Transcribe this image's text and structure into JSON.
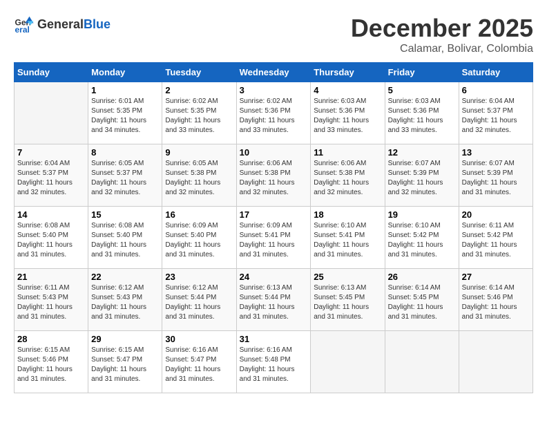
{
  "header": {
    "logo_general": "General",
    "logo_blue": "Blue",
    "month": "December 2025",
    "location": "Calamar, Bolivar, Colombia"
  },
  "weekdays": [
    "Sunday",
    "Monday",
    "Tuesday",
    "Wednesday",
    "Thursday",
    "Friday",
    "Saturday"
  ],
  "weeks": [
    [
      {
        "day": "",
        "sunrise": "",
        "sunset": "",
        "daylight": ""
      },
      {
        "day": "1",
        "sunrise": "Sunrise: 6:01 AM",
        "sunset": "Sunset: 5:35 PM",
        "daylight": "Daylight: 11 hours and 34 minutes."
      },
      {
        "day": "2",
        "sunrise": "Sunrise: 6:02 AM",
        "sunset": "Sunset: 5:35 PM",
        "daylight": "Daylight: 11 hours and 33 minutes."
      },
      {
        "day": "3",
        "sunrise": "Sunrise: 6:02 AM",
        "sunset": "Sunset: 5:36 PM",
        "daylight": "Daylight: 11 hours and 33 minutes."
      },
      {
        "day": "4",
        "sunrise": "Sunrise: 6:03 AM",
        "sunset": "Sunset: 5:36 PM",
        "daylight": "Daylight: 11 hours and 33 minutes."
      },
      {
        "day": "5",
        "sunrise": "Sunrise: 6:03 AM",
        "sunset": "Sunset: 5:36 PM",
        "daylight": "Daylight: 11 hours and 33 minutes."
      },
      {
        "day": "6",
        "sunrise": "Sunrise: 6:04 AM",
        "sunset": "Sunset: 5:37 PM",
        "daylight": "Daylight: 11 hours and 32 minutes."
      }
    ],
    [
      {
        "day": "7",
        "sunrise": "Sunrise: 6:04 AM",
        "sunset": "Sunset: 5:37 PM",
        "daylight": "Daylight: 11 hours and 32 minutes."
      },
      {
        "day": "8",
        "sunrise": "Sunrise: 6:05 AM",
        "sunset": "Sunset: 5:37 PM",
        "daylight": "Daylight: 11 hours and 32 minutes."
      },
      {
        "day": "9",
        "sunrise": "Sunrise: 6:05 AM",
        "sunset": "Sunset: 5:38 PM",
        "daylight": "Daylight: 11 hours and 32 minutes."
      },
      {
        "day": "10",
        "sunrise": "Sunrise: 6:06 AM",
        "sunset": "Sunset: 5:38 PM",
        "daylight": "Daylight: 11 hours and 32 minutes."
      },
      {
        "day": "11",
        "sunrise": "Sunrise: 6:06 AM",
        "sunset": "Sunset: 5:38 PM",
        "daylight": "Daylight: 11 hours and 32 minutes."
      },
      {
        "day": "12",
        "sunrise": "Sunrise: 6:07 AM",
        "sunset": "Sunset: 5:39 PM",
        "daylight": "Daylight: 11 hours and 32 minutes."
      },
      {
        "day": "13",
        "sunrise": "Sunrise: 6:07 AM",
        "sunset": "Sunset: 5:39 PM",
        "daylight": "Daylight: 11 hours and 31 minutes."
      }
    ],
    [
      {
        "day": "14",
        "sunrise": "Sunrise: 6:08 AM",
        "sunset": "Sunset: 5:40 PM",
        "daylight": "Daylight: 11 hours and 31 minutes."
      },
      {
        "day": "15",
        "sunrise": "Sunrise: 6:08 AM",
        "sunset": "Sunset: 5:40 PM",
        "daylight": "Daylight: 11 hours and 31 minutes."
      },
      {
        "day": "16",
        "sunrise": "Sunrise: 6:09 AM",
        "sunset": "Sunset: 5:40 PM",
        "daylight": "Daylight: 11 hours and 31 minutes."
      },
      {
        "day": "17",
        "sunrise": "Sunrise: 6:09 AM",
        "sunset": "Sunset: 5:41 PM",
        "daylight": "Daylight: 11 hours and 31 minutes."
      },
      {
        "day": "18",
        "sunrise": "Sunrise: 6:10 AM",
        "sunset": "Sunset: 5:41 PM",
        "daylight": "Daylight: 11 hours and 31 minutes."
      },
      {
        "day": "19",
        "sunrise": "Sunrise: 6:10 AM",
        "sunset": "Sunset: 5:42 PM",
        "daylight": "Daylight: 11 hours and 31 minutes."
      },
      {
        "day": "20",
        "sunrise": "Sunrise: 6:11 AM",
        "sunset": "Sunset: 5:42 PM",
        "daylight": "Daylight: 11 hours and 31 minutes."
      }
    ],
    [
      {
        "day": "21",
        "sunrise": "Sunrise: 6:11 AM",
        "sunset": "Sunset: 5:43 PM",
        "daylight": "Daylight: 11 hours and 31 minutes."
      },
      {
        "day": "22",
        "sunrise": "Sunrise: 6:12 AM",
        "sunset": "Sunset: 5:43 PM",
        "daylight": "Daylight: 11 hours and 31 minutes."
      },
      {
        "day": "23",
        "sunrise": "Sunrise: 6:12 AM",
        "sunset": "Sunset: 5:44 PM",
        "daylight": "Daylight: 11 hours and 31 minutes."
      },
      {
        "day": "24",
        "sunrise": "Sunrise: 6:13 AM",
        "sunset": "Sunset: 5:44 PM",
        "daylight": "Daylight: 11 hours and 31 minutes."
      },
      {
        "day": "25",
        "sunrise": "Sunrise: 6:13 AM",
        "sunset": "Sunset: 5:45 PM",
        "daylight": "Daylight: 11 hours and 31 minutes."
      },
      {
        "day": "26",
        "sunrise": "Sunrise: 6:14 AM",
        "sunset": "Sunset: 5:45 PM",
        "daylight": "Daylight: 11 hours and 31 minutes."
      },
      {
        "day": "27",
        "sunrise": "Sunrise: 6:14 AM",
        "sunset": "Sunset: 5:46 PM",
        "daylight": "Daylight: 11 hours and 31 minutes."
      }
    ],
    [
      {
        "day": "28",
        "sunrise": "Sunrise: 6:15 AM",
        "sunset": "Sunset: 5:46 PM",
        "daylight": "Daylight: 11 hours and 31 minutes."
      },
      {
        "day": "29",
        "sunrise": "Sunrise: 6:15 AM",
        "sunset": "Sunset: 5:47 PM",
        "daylight": "Daylight: 11 hours and 31 minutes."
      },
      {
        "day": "30",
        "sunrise": "Sunrise: 6:16 AM",
        "sunset": "Sunset: 5:47 PM",
        "daylight": "Daylight: 11 hours and 31 minutes."
      },
      {
        "day": "31",
        "sunrise": "Sunrise: 6:16 AM",
        "sunset": "Sunset: 5:48 PM",
        "daylight": "Daylight: 11 hours and 31 minutes."
      },
      {
        "day": "",
        "sunrise": "",
        "sunset": "",
        "daylight": ""
      },
      {
        "day": "",
        "sunrise": "",
        "sunset": "",
        "daylight": ""
      },
      {
        "day": "",
        "sunrise": "",
        "sunset": "",
        "daylight": ""
      }
    ]
  ]
}
